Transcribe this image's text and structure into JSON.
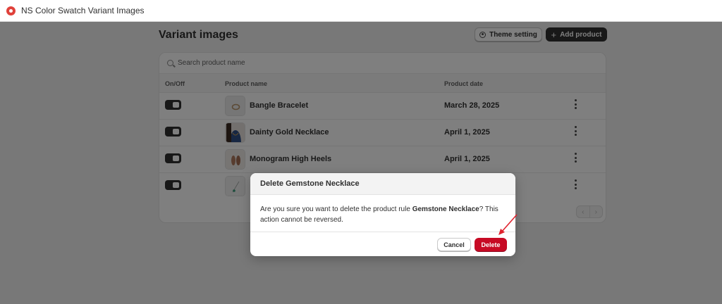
{
  "window": {
    "title": "NS Color Swatch Variant Images"
  },
  "page": {
    "title": "Variant images",
    "theme_button": "Theme setting",
    "add_button": "Add product"
  },
  "search": {
    "placeholder": "Search product name",
    "value": ""
  },
  "table": {
    "headers": {
      "toggle": "On/Off",
      "name": "Product name",
      "date": "Product date"
    },
    "rows": [
      {
        "enabled": true,
        "name": "Bangle Bracelet",
        "date": "March 28, 2025",
        "thumb": "bracelet-image"
      },
      {
        "enabled": true,
        "name": "Dainty Gold Necklace",
        "date": "April 1, 2025",
        "thumb": "necklace-model-image"
      },
      {
        "enabled": true,
        "name": "Monogram High Heels",
        "date": "April 1, 2025",
        "thumb": "heels-image"
      },
      {
        "enabled": true,
        "name": "",
        "date": "",
        "thumb": "gemstone-necklace-image"
      }
    ],
    "pagination": {
      "prev": "‹",
      "next": "›"
    }
  },
  "modal": {
    "title": "Delete Gemstone Necklace",
    "body_prefix": "Are you sure you want to delete the product rule ",
    "body_product": "Gemstone Necklace",
    "body_suffix": "? This action cannot be reversed.",
    "cancel_label": "Cancel",
    "delete_label": "Delete"
  },
  "colors": {
    "primary_dark": "#303030",
    "critical": "#c70a24",
    "annotation_arrow": "#e0232e"
  }
}
